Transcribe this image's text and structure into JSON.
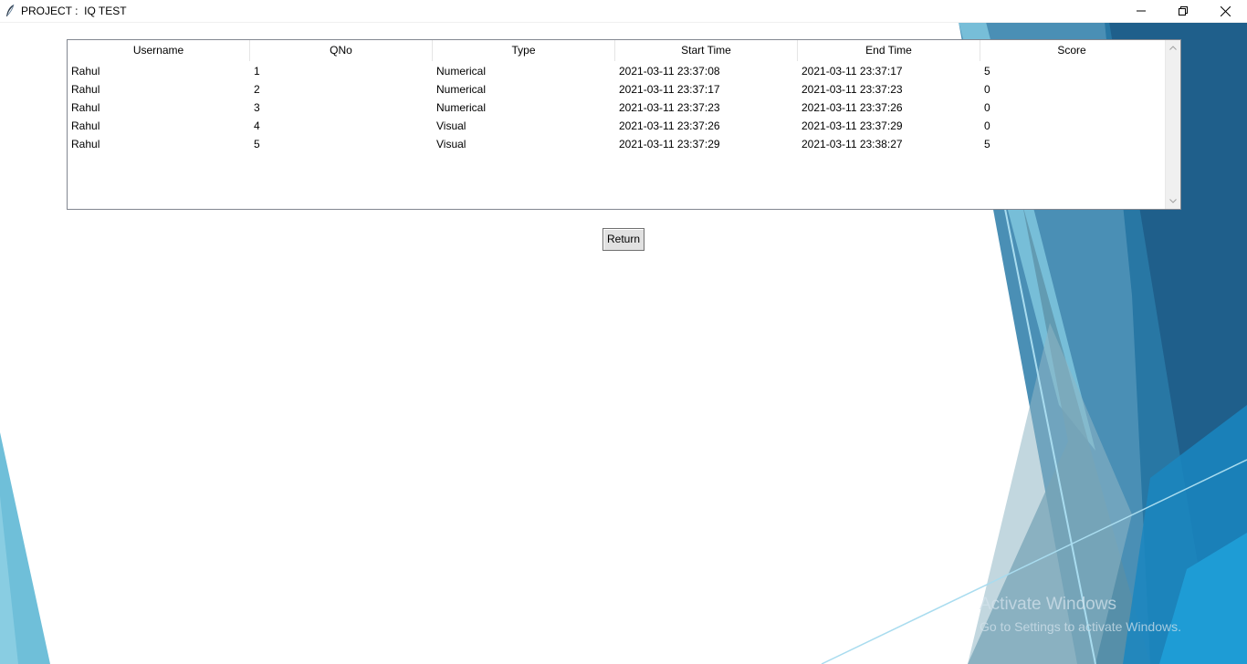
{
  "window": {
    "title": "PROJECT :  IQ TEST",
    "app_icon": "feather-icon",
    "controls": {
      "minimize_icon": "minimize-icon",
      "restore_icon": "restore-icon",
      "close_icon": "close-icon"
    }
  },
  "table": {
    "columns": [
      "Username",
      "QNo",
      "Type",
      "Start Time",
      "End Time",
      "Score"
    ],
    "rows": [
      [
        "Rahul",
        "1",
        "Numerical",
        "2021-03-11 23:37:08",
        "2021-03-11 23:37:17",
        "5"
      ],
      [
        "Rahul",
        "2",
        "Numerical",
        "2021-03-11 23:37:17",
        "2021-03-11 23:37:23",
        "0"
      ],
      [
        "Rahul",
        "3",
        "Numerical",
        "2021-03-11 23:37:23",
        "2021-03-11 23:37:26",
        "0"
      ],
      [
        "Rahul",
        "4",
        "Visual",
        "2021-03-11 23:37:26",
        "2021-03-11 23:37:29",
        "0"
      ],
      [
        "Rahul",
        "5",
        "Visual",
        "2021-03-11 23:37:29",
        "2021-03-11 23:38:27",
        "5"
      ]
    ]
  },
  "buttons": {
    "return_label": "Return"
  },
  "watermark": {
    "title": "Activate Windows",
    "subtitle": "Go to Settings to activate Windows."
  },
  "colors": {
    "accent_dark_blue": "#1f5f8b",
    "accent_mid_blue": "#2e8fb5",
    "accent_light_blue": "#5fb9d6"
  }
}
